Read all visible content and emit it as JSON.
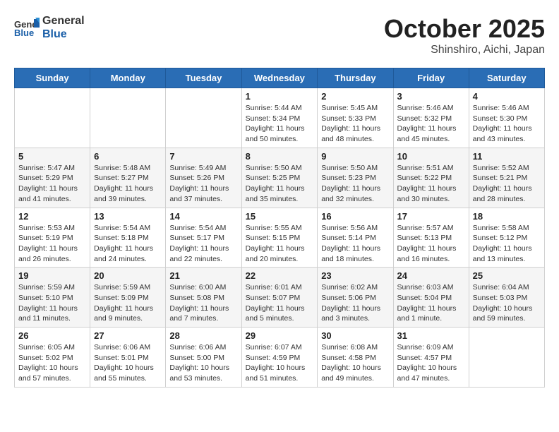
{
  "header": {
    "logo_line1": "General",
    "logo_line2": "Blue",
    "title": "October 2025",
    "subtitle": "Shinshiro, Aichi, Japan"
  },
  "weekdays": [
    "Sunday",
    "Monday",
    "Tuesday",
    "Wednesday",
    "Thursday",
    "Friday",
    "Saturday"
  ],
  "weeks": [
    [
      {
        "day": "",
        "info": ""
      },
      {
        "day": "",
        "info": ""
      },
      {
        "day": "",
        "info": ""
      },
      {
        "day": "1",
        "info": "Sunrise: 5:44 AM\nSunset: 5:34 PM\nDaylight: 11 hours\nand 50 minutes."
      },
      {
        "day": "2",
        "info": "Sunrise: 5:45 AM\nSunset: 5:33 PM\nDaylight: 11 hours\nand 48 minutes."
      },
      {
        "day": "3",
        "info": "Sunrise: 5:46 AM\nSunset: 5:32 PM\nDaylight: 11 hours\nand 45 minutes."
      },
      {
        "day": "4",
        "info": "Sunrise: 5:46 AM\nSunset: 5:30 PM\nDaylight: 11 hours\nand 43 minutes."
      }
    ],
    [
      {
        "day": "5",
        "info": "Sunrise: 5:47 AM\nSunset: 5:29 PM\nDaylight: 11 hours\nand 41 minutes."
      },
      {
        "day": "6",
        "info": "Sunrise: 5:48 AM\nSunset: 5:27 PM\nDaylight: 11 hours\nand 39 minutes."
      },
      {
        "day": "7",
        "info": "Sunrise: 5:49 AM\nSunset: 5:26 PM\nDaylight: 11 hours\nand 37 minutes."
      },
      {
        "day": "8",
        "info": "Sunrise: 5:50 AM\nSunset: 5:25 PM\nDaylight: 11 hours\nand 35 minutes."
      },
      {
        "day": "9",
        "info": "Sunrise: 5:50 AM\nSunset: 5:23 PM\nDaylight: 11 hours\nand 32 minutes."
      },
      {
        "day": "10",
        "info": "Sunrise: 5:51 AM\nSunset: 5:22 PM\nDaylight: 11 hours\nand 30 minutes."
      },
      {
        "day": "11",
        "info": "Sunrise: 5:52 AM\nSunset: 5:21 PM\nDaylight: 11 hours\nand 28 minutes."
      }
    ],
    [
      {
        "day": "12",
        "info": "Sunrise: 5:53 AM\nSunset: 5:19 PM\nDaylight: 11 hours\nand 26 minutes."
      },
      {
        "day": "13",
        "info": "Sunrise: 5:54 AM\nSunset: 5:18 PM\nDaylight: 11 hours\nand 24 minutes."
      },
      {
        "day": "14",
        "info": "Sunrise: 5:54 AM\nSunset: 5:17 PM\nDaylight: 11 hours\nand 22 minutes."
      },
      {
        "day": "15",
        "info": "Sunrise: 5:55 AM\nSunset: 5:15 PM\nDaylight: 11 hours\nand 20 minutes."
      },
      {
        "day": "16",
        "info": "Sunrise: 5:56 AM\nSunset: 5:14 PM\nDaylight: 11 hours\nand 18 minutes."
      },
      {
        "day": "17",
        "info": "Sunrise: 5:57 AM\nSunset: 5:13 PM\nDaylight: 11 hours\nand 16 minutes."
      },
      {
        "day": "18",
        "info": "Sunrise: 5:58 AM\nSunset: 5:12 PM\nDaylight: 11 hours\nand 13 minutes."
      }
    ],
    [
      {
        "day": "19",
        "info": "Sunrise: 5:59 AM\nSunset: 5:10 PM\nDaylight: 11 hours\nand 11 minutes."
      },
      {
        "day": "20",
        "info": "Sunrise: 5:59 AM\nSunset: 5:09 PM\nDaylight: 11 hours\nand 9 minutes."
      },
      {
        "day": "21",
        "info": "Sunrise: 6:00 AM\nSunset: 5:08 PM\nDaylight: 11 hours\nand 7 minutes."
      },
      {
        "day": "22",
        "info": "Sunrise: 6:01 AM\nSunset: 5:07 PM\nDaylight: 11 hours\nand 5 minutes."
      },
      {
        "day": "23",
        "info": "Sunrise: 6:02 AM\nSunset: 5:06 PM\nDaylight: 11 hours\nand 3 minutes."
      },
      {
        "day": "24",
        "info": "Sunrise: 6:03 AM\nSunset: 5:04 PM\nDaylight: 11 hours\nand 1 minute."
      },
      {
        "day": "25",
        "info": "Sunrise: 6:04 AM\nSunset: 5:03 PM\nDaylight: 10 hours\nand 59 minutes."
      }
    ],
    [
      {
        "day": "26",
        "info": "Sunrise: 6:05 AM\nSunset: 5:02 PM\nDaylight: 10 hours\nand 57 minutes."
      },
      {
        "day": "27",
        "info": "Sunrise: 6:06 AM\nSunset: 5:01 PM\nDaylight: 10 hours\nand 55 minutes."
      },
      {
        "day": "28",
        "info": "Sunrise: 6:06 AM\nSunset: 5:00 PM\nDaylight: 10 hours\nand 53 minutes."
      },
      {
        "day": "29",
        "info": "Sunrise: 6:07 AM\nSunset: 4:59 PM\nDaylight: 10 hours\nand 51 minutes."
      },
      {
        "day": "30",
        "info": "Sunrise: 6:08 AM\nSunset: 4:58 PM\nDaylight: 10 hours\nand 49 minutes."
      },
      {
        "day": "31",
        "info": "Sunrise: 6:09 AM\nSunset: 4:57 PM\nDaylight: 10 hours\nand 47 minutes."
      },
      {
        "day": "",
        "info": ""
      }
    ]
  ]
}
